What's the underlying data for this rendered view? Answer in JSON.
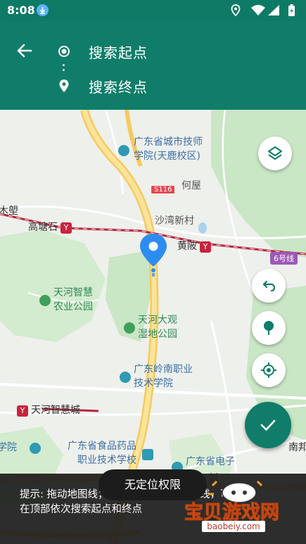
{
  "status_bar": {
    "time": "8:08",
    "icons": [
      "download-icon",
      "location-icon",
      "wifi-icon",
      "signal-icon",
      "battery-icon"
    ]
  },
  "header": {
    "origin_placeholder": "搜索起点",
    "destination_placeholder": "搜索终点"
  },
  "map": {
    "labels": {
      "school_1a": "广东省城市技师",
      "school_1b": "学院(天鹿校区)",
      "heyu": "何屋",
      "road_s116": "S116",
      "shawan": "沙湾新村",
      "mushu": "木塱",
      "gaotangshi": "高塘石",
      "huangpi": "黄陂",
      "line6": "6号线",
      "park_1a": "天河智慧",
      "park_1b": "农业公园",
      "wetland_a": "天河大观",
      "wetland_b": "湿地公园",
      "school_2a": "广东岭南职业",
      "school_2b": "技术学院",
      "smartcity": "天河智慧城",
      "xueyuan": "学院",
      "school_3a": "广东省食品药品",
      "school_3b": "职业技术学校",
      "electronics": "广东省电子",
      "nanbang": "南邦",
      "liu": "刘"
    },
    "colors": {
      "primary": "#0f7d69",
      "pin": "#2d8cf0",
      "highway": "#f7c95e",
      "rail": "#b8263f",
      "green_area": "#c9e6c5"
    }
  },
  "controls": {
    "layers": "layers-icon",
    "undo": "undo-icon",
    "marker": "marker-icon",
    "locate": "locate-icon",
    "confirm": "check-icon"
  },
  "hint": {
    "text": "提示: 拖动地图线；若需自动规划导航路线，可在顶部依次搜索起点和终点"
  },
  "toast": {
    "text": "无定位权限"
  },
  "watermark": {
    "text": "宝贝游戏网",
    "url": "baobeiy.com"
  }
}
